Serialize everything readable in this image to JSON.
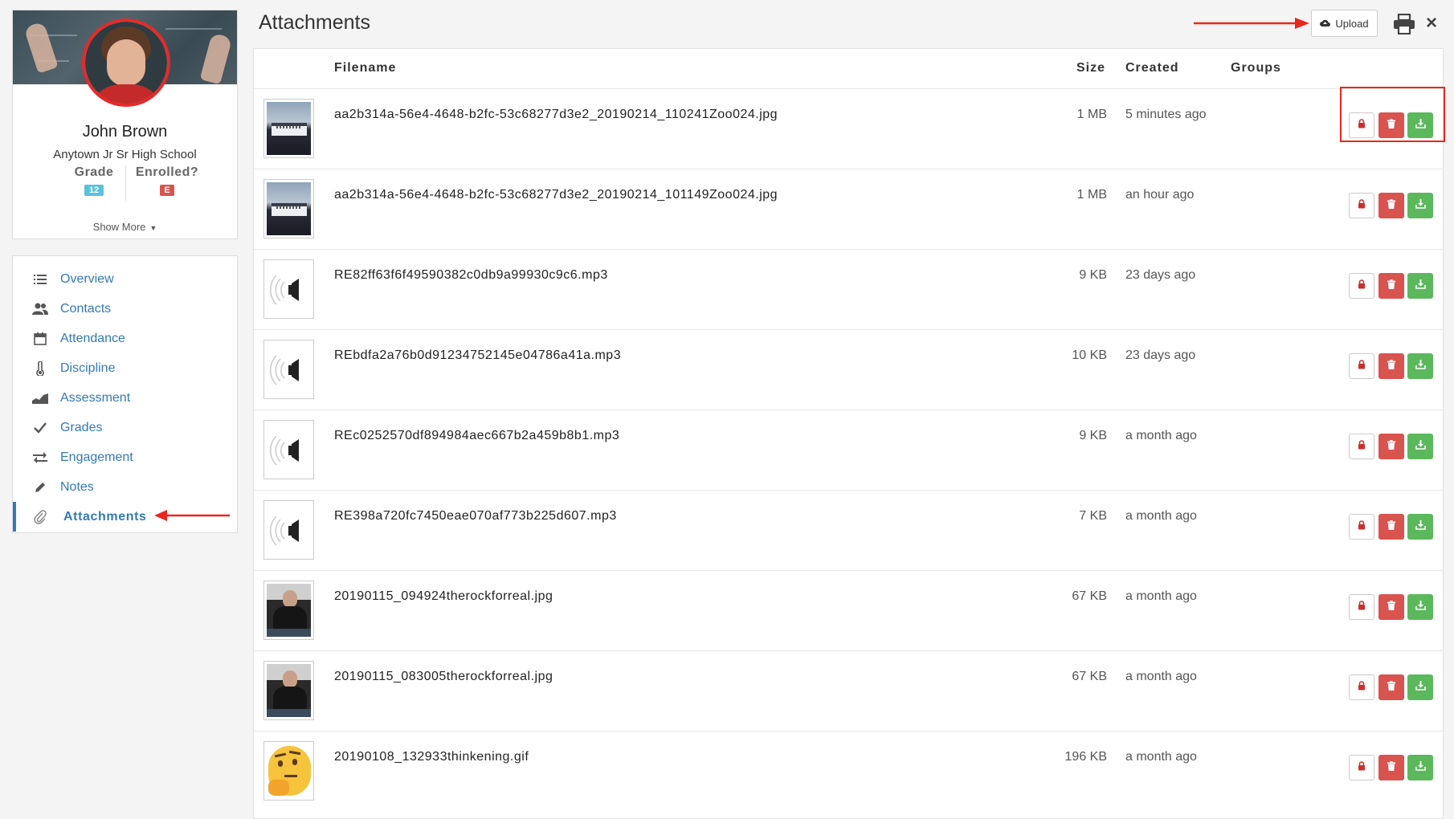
{
  "profile": {
    "name": "John Brown",
    "school": "Anytown Jr Sr High School",
    "grade_label": "Grade",
    "grade_value": "12",
    "enrolled_label": "Enrolled?",
    "enrolled_value": "E",
    "show_more": "Show More"
  },
  "nav": {
    "items": [
      {
        "label": "Overview",
        "icon": "list-icon"
      },
      {
        "label": "Contacts",
        "icon": "users-icon"
      },
      {
        "label": "Attendance",
        "icon": "calendar-icon"
      },
      {
        "label": "Discipline",
        "icon": "thermometer-icon"
      },
      {
        "label": "Assessment",
        "icon": "area-chart-icon"
      },
      {
        "label": "Grades",
        "icon": "checkmark-icon"
      },
      {
        "label": "Engagement",
        "icon": "exchange-icon"
      },
      {
        "label": "Notes",
        "icon": "pencil-icon"
      },
      {
        "label": "Attachments",
        "icon": "paperclip-icon"
      }
    ],
    "active": "Attachments"
  },
  "header": {
    "title": "Attachments",
    "upload_label": "Upload"
  },
  "table": {
    "columns": {
      "filename": "Filename",
      "size": "Size",
      "created": "Created",
      "groups": "Groups"
    },
    "rows": [
      {
        "filename": "aa2b314a-56e4-4648-b2fc-53c68277d3e2_20190214_110241Zoo024.jpg",
        "size": "1 MB",
        "created": "5 minutes ago",
        "thumb": "building"
      },
      {
        "filename": "aa2b314a-56e4-4648-b2fc-53c68277d3e2_20190214_101149Zoo024.jpg",
        "size": "1 MB",
        "created": "an hour ago",
        "thumb": "building"
      },
      {
        "filename": "RE82ff63f6f49590382c0db9a99930c9c6.mp3",
        "size": "9 KB",
        "created": "23 days ago",
        "thumb": "audio"
      },
      {
        "filename": "REbdfa2a76b0d91234752145e04786a41a.mp3",
        "size": "10 KB",
        "created": "23 days ago",
        "thumb": "audio"
      },
      {
        "filename": "REc0252570df894984aec667b2a459b8b1.mp3",
        "size": "9 KB",
        "created": "a month ago",
        "thumb": "audio"
      },
      {
        "filename": "RE398a720fc7450eae070af773b225d607.mp3",
        "size": "7 KB",
        "created": "a month ago",
        "thumb": "audio"
      },
      {
        "filename": "20190115_094924therockforreal.jpg",
        "size": "67 KB",
        "created": "a month ago",
        "thumb": "person"
      },
      {
        "filename": "20190115_083005therockforreal.jpg",
        "size": "67 KB",
        "created": "a month ago",
        "thumb": "person"
      },
      {
        "filename": "20190108_132933thinkening.gif",
        "size": "196 KB",
        "created": "a month ago",
        "thumb": "emoji"
      }
    ]
  },
  "colors": {
    "link": "#337ab7",
    "delete": "#d9534f",
    "download": "#5cb85c",
    "annotation": "#e8271d"
  }
}
